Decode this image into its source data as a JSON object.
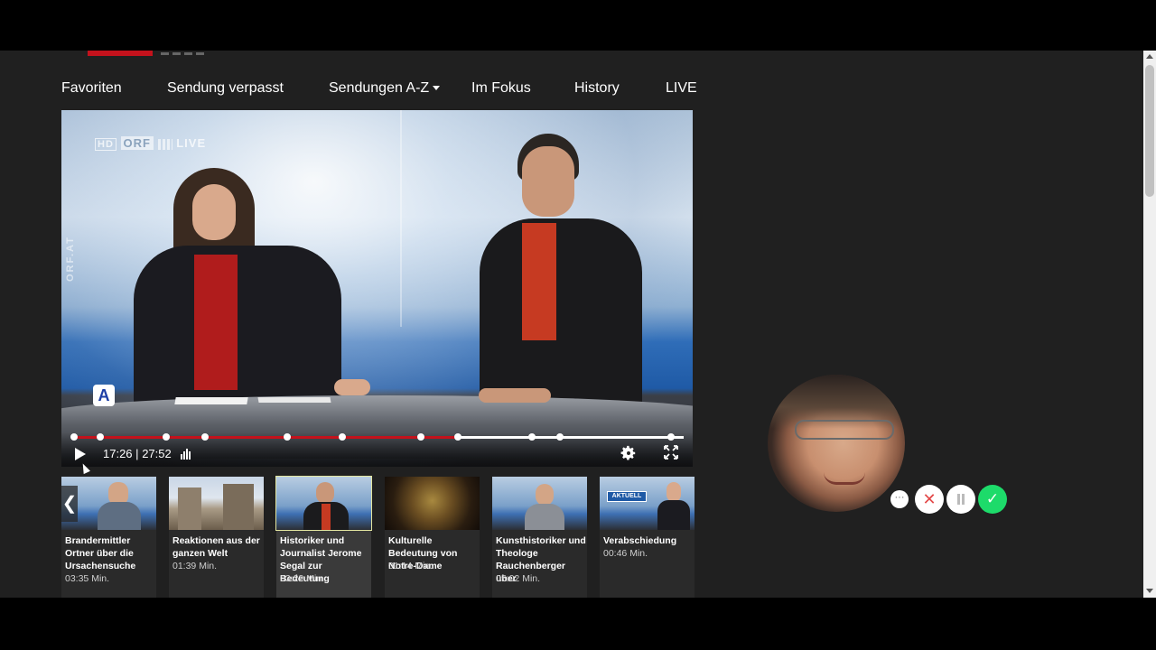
{
  "nav": {
    "items": [
      {
        "label": "Favoriten"
      },
      {
        "label": "Sendung verpasst"
      },
      {
        "label": "Sendungen A-Z"
      },
      {
        "label": "Im Fokus"
      },
      {
        "label": "History"
      },
      {
        "label": "LIVE"
      }
    ]
  },
  "player": {
    "bug": {
      "hd": "HD",
      "orf": "ORF",
      "live": "LIVE"
    },
    "side_mark": "ORF.AT",
    "logo_letter": "A",
    "current_time": "17:26",
    "duration": "27:52",
    "time_separator": "|",
    "progress_fraction": 0.625,
    "icons": [
      "play-icon",
      "volume-icon",
      "gear-icon",
      "fullscreen-icon"
    ],
    "colors": {
      "progress": "#c4121c"
    }
  },
  "playlist": {
    "prev_arrow": "❮",
    "next_arrow": "❯",
    "items": [
      {
        "title": "Brandermittler Ortner über die Ursachensuche",
        "duration": "03:35 Min."
      },
      {
        "title": "Reaktionen aus der ganzen Welt",
        "duration": "01:39 Min."
      },
      {
        "title": "Historiker und Journalist Jerome Segal zur Bedeutung",
        "duration": "03:22 Min."
      },
      {
        "title": "Kulturelle Bedeutung von Notre-Dame",
        "duration": "01:14 Min."
      },
      {
        "title": "Kunsthistoriker und Theologe Rauchenberger über",
        "duration": "05:02 Min."
      },
      {
        "title": "Verabschiedung",
        "duration": "00:46 Min."
      }
    ],
    "active_index": 2,
    "thumb_badge": "AKTUELL"
  },
  "recorder": {
    "more": "···",
    "close": "✕",
    "confirm": "✓",
    "colors": {
      "confirm": "#1ddb6a",
      "close": "#e34848"
    }
  }
}
